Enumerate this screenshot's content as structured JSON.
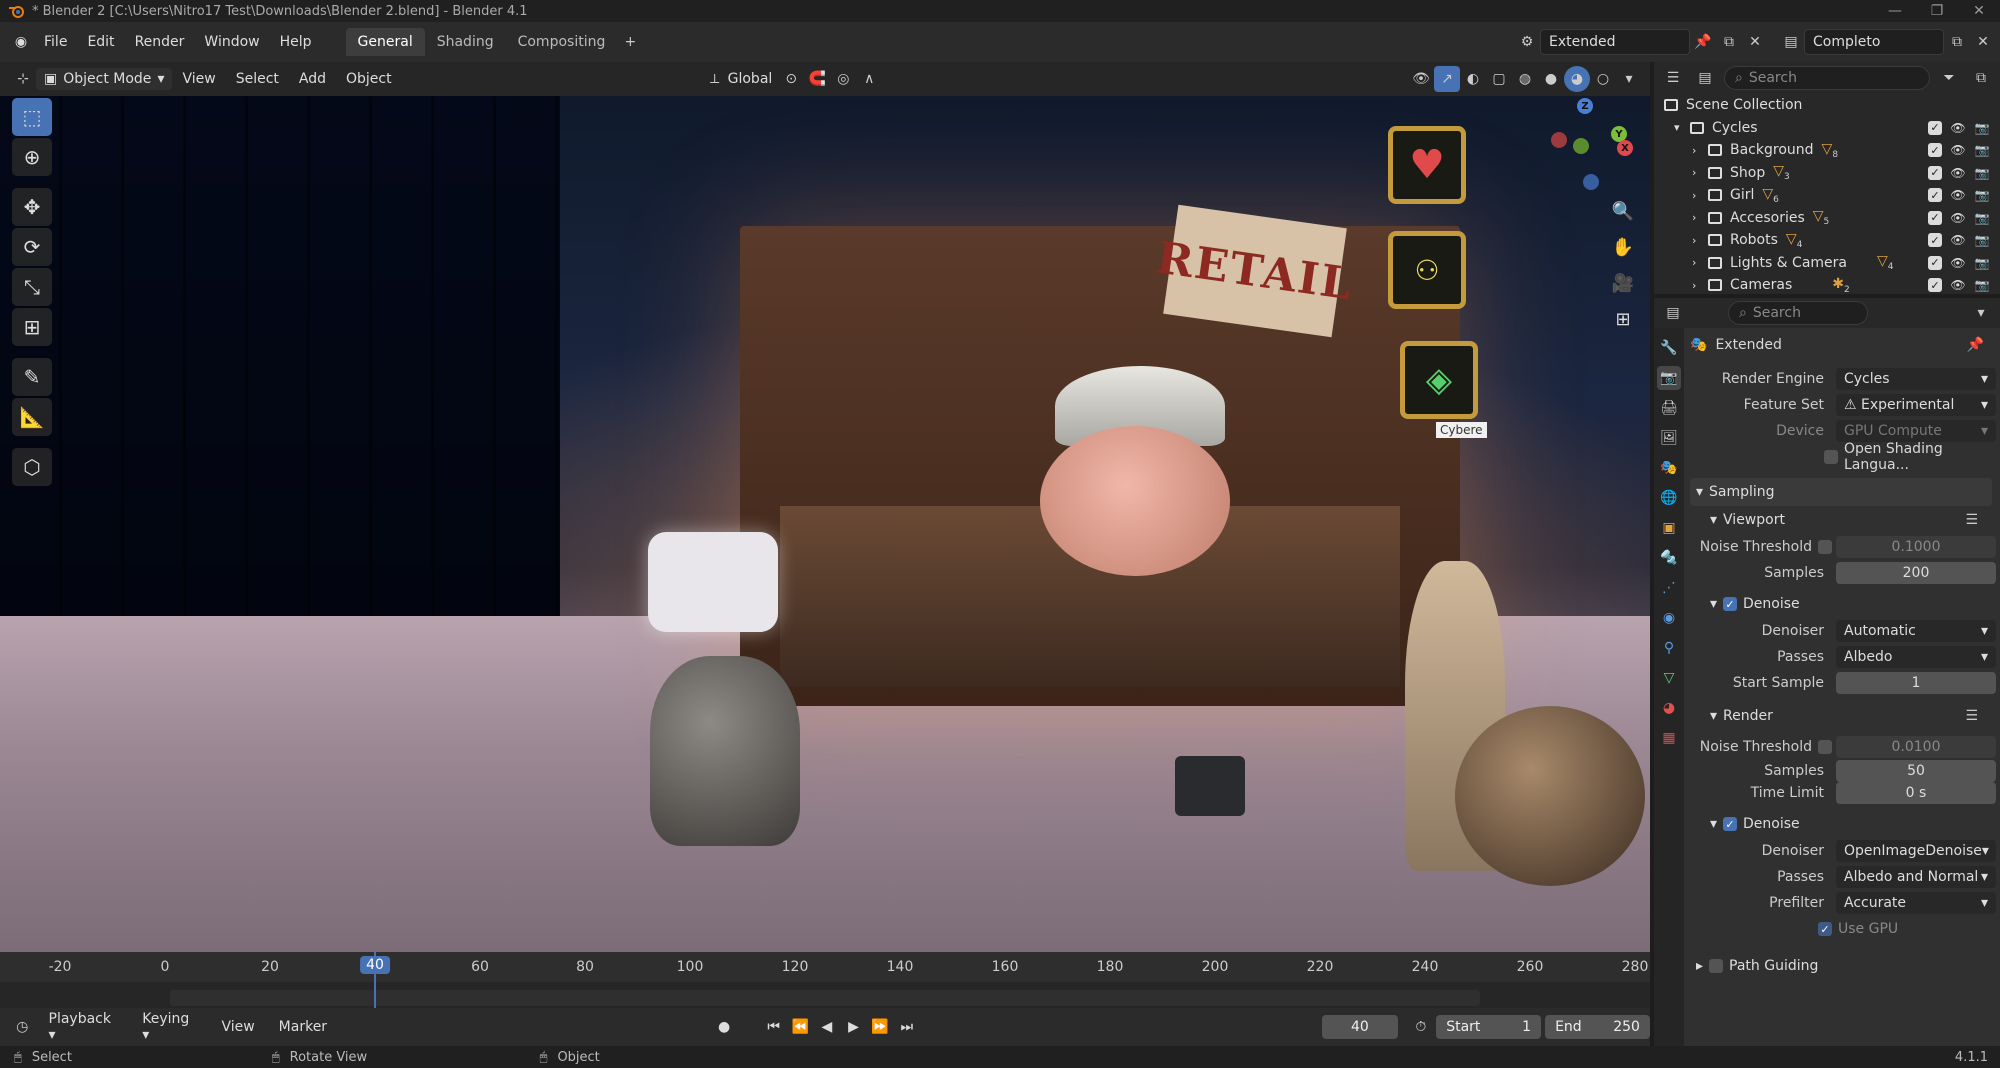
{
  "window": {
    "title": "* Blender 2 [C:\\Users\\Nitro17 Test\\Downloads\\Blender 2.blend] - Blender 4.1"
  },
  "menu": [
    "File",
    "Edit",
    "Render",
    "Window",
    "Help"
  ],
  "workspaces": [
    "General",
    "Shading",
    "Compositing"
  ],
  "topright": {
    "scene_name": "Extended",
    "viewlayer_name": "Completo"
  },
  "viewport_header": {
    "mode": "Object Mode",
    "menus": [
      "View",
      "Select",
      "Add",
      "Object"
    ],
    "orientation": "Global"
  },
  "viewport": {
    "sign_text": "RETAIL",
    "tooltip": "Cybere"
  },
  "outliner": {
    "search_placeholder": "Search",
    "scene_collection": "Scene Collection",
    "root": "Cycles",
    "items": [
      {
        "name": "Background",
        "badge": "8"
      },
      {
        "name": "Shop",
        "badge": "3"
      },
      {
        "name": "Girl",
        "badge": "6"
      },
      {
        "name": "Accesories",
        "badge": "5"
      },
      {
        "name": "Robots",
        "badge": "4"
      },
      {
        "name": "Lights & Camera",
        "badge": "4"
      },
      {
        "name": "Cameras",
        "badge": "2"
      }
    ]
  },
  "properties": {
    "search_placeholder": "Search",
    "scene": "Extended",
    "render_engine_label": "Render Engine",
    "render_engine": "Cycles",
    "feature_set_label": "Feature Set",
    "feature_set": "Experimental",
    "device_label": "Device",
    "device": "GPU Compute",
    "osl": "Open Shading Langua...",
    "sampling": "Sampling",
    "viewport": {
      "title": "Viewport",
      "noise_threshold_label": "Noise Threshold",
      "noise_threshold": "0.1000",
      "samples_label": "Samples",
      "samples": "200",
      "denoise": "Denoise",
      "denoiser_label": "Denoiser",
      "denoiser": "Automatic",
      "passes_label": "Passes",
      "passes": "Albedo",
      "start_sample_label": "Start Sample",
      "start_sample": "1"
    },
    "render": {
      "title": "Render",
      "noise_threshold_label": "Noise Threshold",
      "noise_threshold": "0.0100",
      "samples_label": "Samples",
      "samples": "50",
      "time_limit_label": "Time Limit",
      "time_limit": "0 s",
      "denoise": "Denoise",
      "denoiser_label": "Denoiser",
      "denoiser": "OpenImageDenoise",
      "passes_label": "Passes",
      "passes": "Albedo and Normal",
      "prefilter_label": "Prefilter",
      "prefilter": "Accurate",
      "use_gpu": "Use GPU"
    },
    "path_guiding": "Path Guiding"
  },
  "timeline": {
    "ticks": [
      "-20",
      "0",
      "20",
      "40",
      "60",
      "80",
      "100",
      "120",
      "140",
      "160",
      "180",
      "200",
      "220",
      "240",
      "260",
      "280"
    ],
    "current_frame": "40",
    "menus": [
      "Playback",
      "Keying",
      "View",
      "Marker"
    ],
    "frame_field": "40",
    "start_label": "Start",
    "start": "1",
    "end_label": "End",
    "end": "250"
  },
  "statusbar": {
    "select": "Select",
    "rotate": "Rotate View",
    "object": "Object",
    "version": "4.1.1"
  }
}
